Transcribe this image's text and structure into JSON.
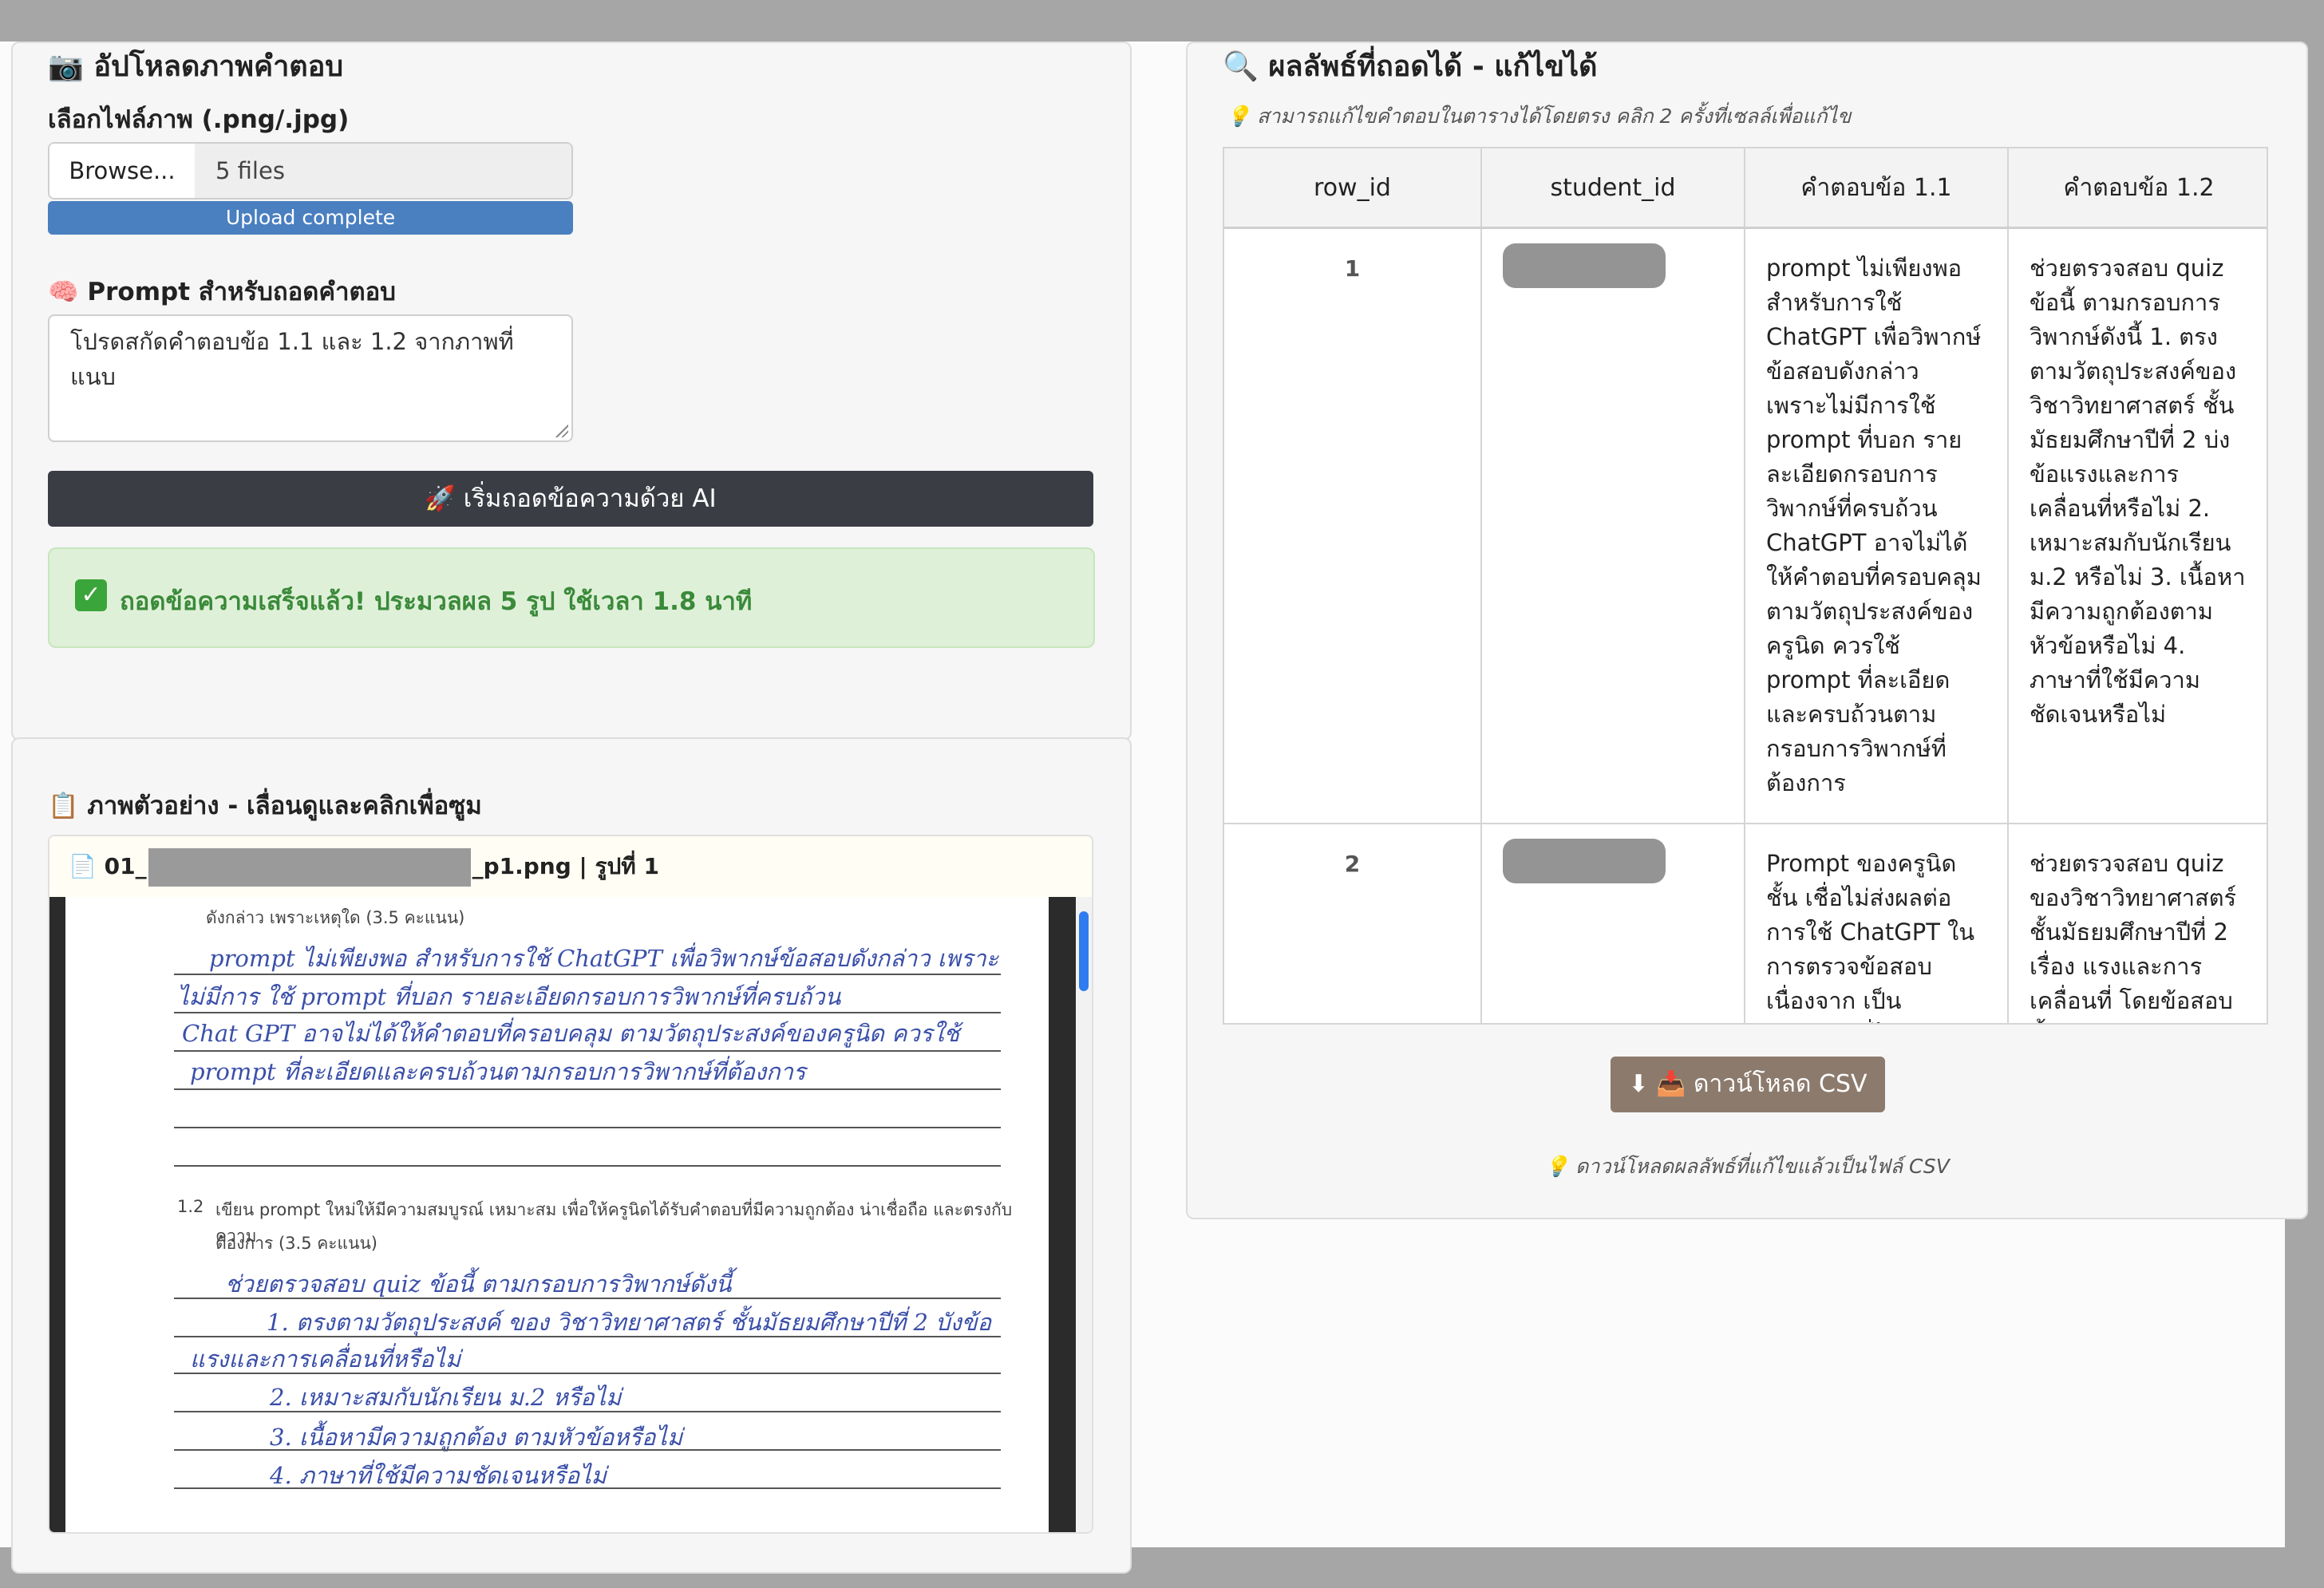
{
  "upload": {
    "title": "📷 อัปโหลดภาพคำตอบ",
    "file_label": "เลือกไฟล์ภาพ (.png/.jpg)",
    "browse_label": "Browse...",
    "file_count": "5 files",
    "progress_text": "Upload complete",
    "progress_value": 1.0,
    "prompt_label": "🧠 Prompt สำหรับถอดคำตอบ",
    "prompt_value": "โปรดสกัดคำตอบข้อ 1.1 และ 1.2 จากภาพที่แนบ",
    "run_button": "🚀 เริ่มถอดข้อความด้วย AI",
    "success_icon": "✓",
    "success_message": "ถอดข้อความเสร็จแล้ว! ประมวลผล 5 รูป ใช้เวลา 1.8 นาที"
  },
  "preview": {
    "title": "📋 ภาพตัวอย่าง - เลื่อนดูและคลิกเพื่อซูม",
    "file_prefix": "📄 01_",
    "file_suffix": "_p1.png | รูปที่ 1",
    "doc": {
      "q11_tail": "ดังกล่าว เพราะเหตุใด (3.5 คะแนน)",
      "q11_lines": [
        "prompt ไม่เพียงพอ สำหรับการใช้  ChatGPT เพื่อวิพากษ์ข้อสอบดังกล่าว เพราะ",
        "ไม่มีการ ใช้ prompt ที่บอก รายละเอียดกรอบการวิพากษ์ที่ครบถ้วน",
        "Chat GPT อาจไม่ได้ให้คำตอบที่ครอบคลุม ตามวัตถุประสงค์ของครูนิด ควรใช้",
        "prompt ที่ละเอียดและครบถ้วนตามกรอบการวิพากษ์ที่ต้องการ"
      ],
      "q12_num": "1.2",
      "q12_text": "เขียน prompt ใหม่ให้มีความสมบูรณ์ เหมาะสม เพื่อให้ครูนิดได้รับคำตอบที่มีความถูกต้อง น่าเชื่อถือ และตรงกับความ",
      "q12_text2": "ต้องการ (3.5 คะแนน)",
      "q12_lines": [
        "ช่วยตรวจสอบ quiz ข้อนี้ ตามกรอบการวิพากษ์ดังนี้",
        "1. ตรงตามวัตถุประสงค์ ของ วิชาวิทยาศาสตร์ ชั้นมัธยมศึกษาปีที่ 2 บังข้อ",
        "แรงและการเคลื่อนที่หรือไม่",
        "2. เหมาะสมกับนักเรียน ม.2 หรือไม่",
        "3. เนื้อหามีความถูกต้อง ตามหัวข้อหรือไม่",
        "4.  ภาษาที่ใช้มีความชัดเจนหรือไม่"
      ]
    }
  },
  "results": {
    "title": "🔍 ผลลัพธ์ที่ถอดได้ - แก้ไขได้",
    "hint": "💡 สามารถแก้ไขคำตอบในตารางได้โดยตรง คลิก 2 ครั้งที่เซลล์เพื่อแก้ไข",
    "columns": [
      "row_id",
      "student_id",
      "คำตอบข้อ 1.1",
      "คำตอบข้อ 1.2"
    ],
    "rows": [
      {
        "row_id": "1",
        "answer_11": "prompt ไม่เพียงพอสำหรับการใช้ ChatGPT เพื่อวิพากษ์ข้อสอบดังกล่าว เพราะไม่มีการใช้ prompt ที่บอก รายละเอียดกรอบการวิพากษ์ที่ครบถ้วน ChatGPT อาจไม่ได้ให้คำตอบที่ครอบคลุมตามวัตถุประสงค์ของครูนิด ควรใช้ prompt ที่ละเอียดและครบถ้วนตามกรอบการวิพากษ์ที่ต้องการ",
        "answer_12": "ช่วยตรวจสอบ quiz ข้อนี้ ตามกรอบการวิพากษ์ดังนี้ 1. ตรงตามวัตถุประสงค์ของวิชาวิทยาศาสตร์ ชั้นมัธยมศึกษาปีที่ 2 บ่งข้อแรงและการเคลื่อนที่หรือไม่ 2. เหมาะสมกับนักเรียน ม.2 หรือไม่ 3. เนื้อหามีความถูกต้องตามหัวข้อหรือไม่ 4. ภาษาที่ใช้มีความชัดเจนหรือไม่"
      },
      {
        "row_id": "2",
        "answer_11": "Prompt ของครูนิดชั้น เชื่อไม่ส่งผลต่อการใช้ ChatGPT ในการตรวจข้อสอบ เนื่องจาก เป็น prompt ที่ไม่",
        "answer_12": "ช่วยตรวจสอบ quiz ของวิชาวิทยาศาสตร์ ชั้นมัธยมศึกษาปีที่ 2 เรื่อง แรงและการเคลื่อนที่ โดยข้อสอบนี้ต้องสามารถอธิบายได้"
      }
    ],
    "download_button": "⬇ 📥 ดาวน์โหลด CSV",
    "download_hint": "💡 ดาวน์โหลดผลลัพธ์ที่แก้ไขแล้วเป็นไฟล์ CSV"
  }
}
